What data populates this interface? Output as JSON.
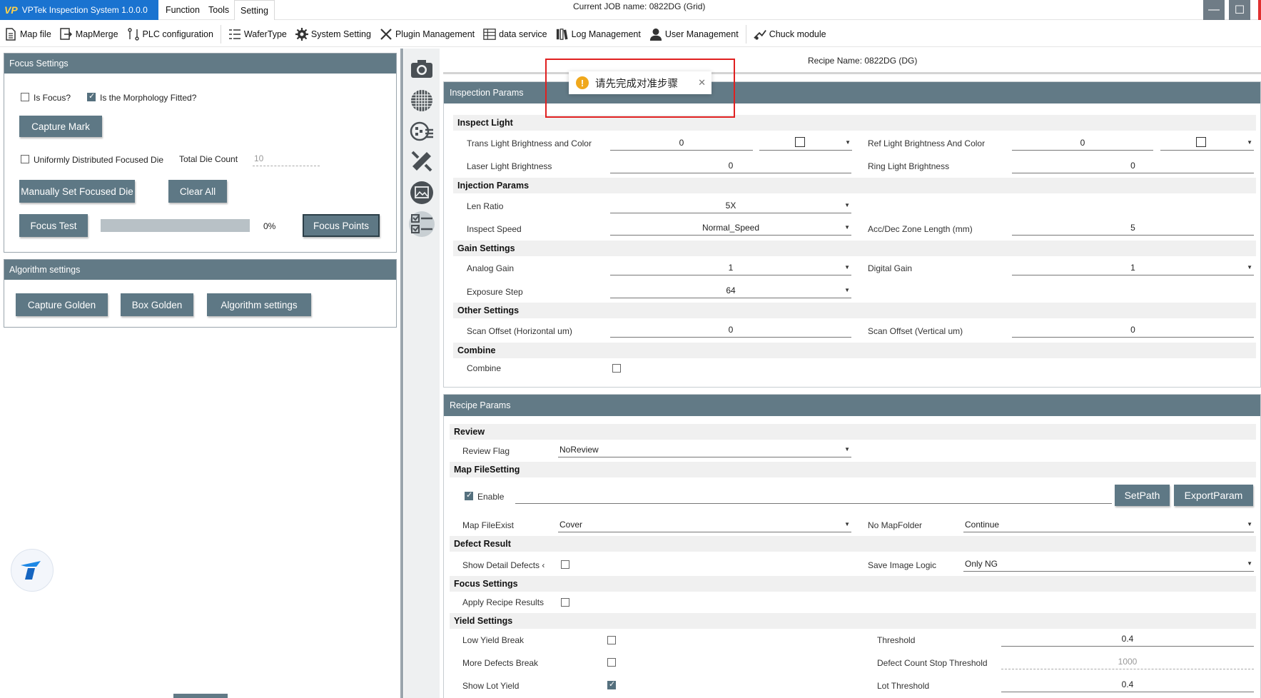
{
  "app": {
    "title": "VPTek Inspection System 1.0.0.0",
    "logo_text": "VP",
    "job_name": "Current JOB name:  0822DG (Grid)"
  },
  "menu": [
    {
      "label": "Function"
    },
    {
      "label": "Tools"
    },
    {
      "label": "Setting"
    }
  ],
  "toolbar": [
    {
      "label": "Map file",
      "icon": "document-icon"
    },
    {
      "label": "MapMerge",
      "icon": "merge-icon"
    },
    {
      "label": "PLC configuration",
      "icon": "plc-icon"
    },
    {
      "label": "WaferType",
      "icon": "list-icon"
    },
    {
      "label": "System Setting",
      "icon": "gear-icon"
    },
    {
      "label": "Plugin Management",
      "icon": "tools-icon"
    },
    {
      "label": "data service",
      "icon": "database-icon"
    },
    {
      "label": "Log Management",
      "icon": "books-icon"
    },
    {
      "label": "User Management",
      "icon": "user-icon"
    },
    {
      "label": "Chuck module",
      "icon": "chuck-icon"
    }
  ],
  "focus_settings": {
    "title": "Focus Settings",
    "is_focus_label": "Is Focus?",
    "is_focus_checked": false,
    "morph_label": "Is the Morphology Fitted?",
    "morph_checked": true,
    "capture_mark": "Capture Mark",
    "uniform_label": "Uniformly Distributed Focused Die",
    "uniform_checked": false,
    "total_die_label": "Total Die Count",
    "total_die_value": "10",
    "manual_set": "Manually Set Focused Die",
    "clear_all": "Clear All",
    "focus_test": "Focus Test",
    "progress_percent": 0,
    "progress_text": "0%",
    "focus_points": "Focus Points"
  },
  "algorithm_settings": {
    "title": "Algorithm settings",
    "capture_golden": "Capture Golden",
    "box_golden": "Box Golden",
    "algorithm_button": "Algorithm settings"
  },
  "rail": [
    "camera-icon",
    "wafer-grid-icon",
    "map-list-icon",
    "ruler-icon",
    "image-gallery-icon",
    "checklist-icon"
  ],
  "recipe": {
    "name": "Recipe Name: 0822DG (DG)"
  },
  "toast": {
    "message": "请先完成对准步骤",
    "icon": "warning-icon"
  },
  "inspection": {
    "title": "Inspection Params",
    "groups": {
      "inspect_light": "Inspect Light",
      "inspection_params": "Injection Params",
      "gain": "Gain Settings",
      "other": "Other Settings",
      "combine": "Combine"
    },
    "trans_light_label": "Trans Light Brightness and Color",
    "trans_light_value": "0",
    "ref_light_label": "Ref Light Brightness And Color",
    "ref_light_value": "0",
    "laser_label": "Laser Light Brightness",
    "laser_value": "0",
    "ring_label": "Ring Light Brightness",
    "ring_value": "0",
    "len_ratio_label": "Len Ratio",
    "len_ratio_value": "5X",
    "inspect_speed_label": "Inspect Speed",
    "inspect_speed_value": "Normal_Speed",
    "acc_label": "Acc/Dec Zone Length (mm)",
    "acc_value": "5",
    "analog_label": "Analog Gain",
    "analog_value": "1",
    "digital_label": "Digital Gain",
    "digital_value": "1",
    "exposure_label": "Exposure Step",
    "exposure_value": "64",
    "scan_h_label": "Scan Offset (Horizontal um)",
    "scan_h_value": "0",
    "scan_v_label": "Scan Offset (Vertical um)",
    "scan_v_value": "0",
    "combine_label": "Combine",
    "combine_checked": false
  },
  "recipe_params": {
    "title": "Recipe Params",
    "groups": {
      "review": "Review",
      "map_file": "Map FileSetting",
      "defect": "Defect Result",
      "focus": "Focus Settings",
      "yield": "Yield Settings"
    },
    "review_flag_label": "Review Flag",
    "review_flag_value": "NoReview",
    "enable_label": "Enable",
    "enable_checked": true,
    "path_value": "",
    "set_path": "SetPath",
    "export_param": "ExportParam",
    "map_exist_label": "Map FileExist",
    "map_exist_value": "Cover",
    "no_map_label": "No MapFolder",
    "no_map_value": "Continue",
    "show_detail_label": "Show Detail Defects ‹",
    "show_detail_checked": false,
    "save_image_label": "Save Image Logic",
    "save_image_value": "Only NG",
    "apply_recipe_label": "Apply Recipe Results",
    "apply_recipe_checked": false,
    "low_yield_label": "Low Yield Break",
    "low_yield_checked": false,
    "threshold_label": "Threshold",
    "threshold_value": "0.4",
    "more_defects_label": "More Defects Break",
    "more_defects_checked": false,
    "defect_stop_label": "Defect Count Stop Threshold",
    "defect_stop_value": "1000",
    "show_lot_label": "Show Lot Yield",
    "show_lot_checked": true,
    "lot_threshold_label": "Lot Threshold",
    "lot_threshold_value": "0.4"
  },
  "colors": {
    "header": "#627a86",
    "button": "#5e7885",
    "title_bg": "#1a73d0",
    "warning": "#f0a81c",
    "highlight_frame": "#e02020"
  }
}
